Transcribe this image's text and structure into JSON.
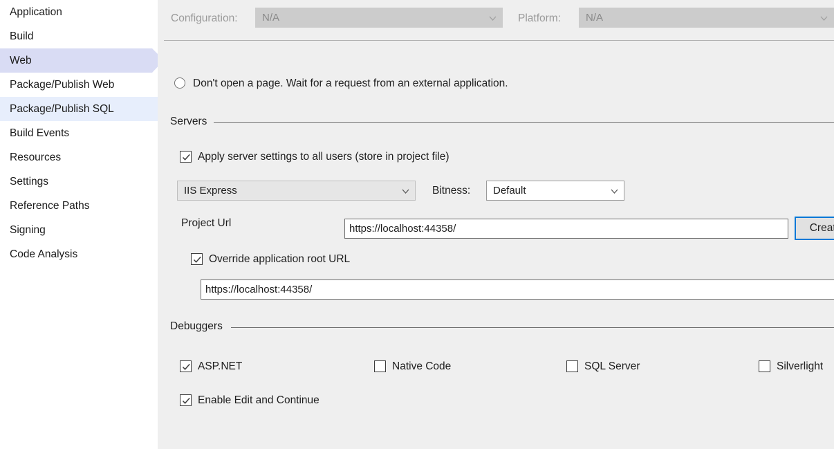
{
  "sidebar": {
    "items": [
      {
        "label": "Application",
        "state": "normal"
      },
      {
        "label": "Build",
        "state": "normal"
      },
      {
        "label": "Web",
        "state": "selected"
      },
      {
        "label": "Package/Publish Web",
        "state": "normal"
      },
      {
        "label": "Package/Publish SQL",
        "state": "hovered"
      },
      {
        "label": "Build Events",
        "state": "normal"
      },
      {
        "label": "Resources",
        "state": "normal"
      },
      {
        "label": "Settings",
        "state": "normal"
      },
      {
        "label": "Reference Paths",
        "state": "normal"
      },
      {
        "label": "Signing",
        "state": "normal"
      },
      {
        "label": "Code Analysis",
        "state": "normal"
      }
    ]
  },
  "header": {
    "configuration_label": "Configuration:",
    "configuration_value": "N/A",
    "platform_label": "Platform:",
    "platform_value": "N/A"
  },
  "start_action": {
    "dont_open_page_label": "Don't open a page.  Wait for a request from an external application.",
    "dont_open_page_checked": false
  },
  "servers": {
    "group_title": "Servers",
    "apply_all_users_label": "Apply server settings to all users (store in project file)",
    "apply_all_users_checked": true,
    "server_value": "IIS Express",
    "bitness_label": "Bitness:",
    "bitness_value": "Default",
    "project_url_label": "Project Url",
    "project_url_value": "https://localhost:44358/",
    "create_button_label": "Create",
    "override_root_url_label": "Override application root URL",
    "override_root_url_checked": true,
    "override_root_url_value": "https://localhost:44358/"
  },
  "debuggers": {
    "group_title": "Debuggers",
    "options": [
      {
        "label": "ASP.NET",
        "checked": true
      },
      {
        "label": "Native Code",
        "checked": false
      },
      {
        "label": "SQL Server",
        "checked": false
      },
      {
        "label": "Silverlight",
        "checked": false
      },
      {
        "label": "Enable Edit and Continue",
        "checked": true
      }
    ]
  },
  "colors": {
    "panel_background": "#efefef",
    "sidebar_background": "#ffffff",
    "selected_item": "#d9dcf4",
    "hovered_item": "#e7eefc",
    "focus_border": "#0078d7",
    "group_rule": "#6e6e6e"
  }
}
